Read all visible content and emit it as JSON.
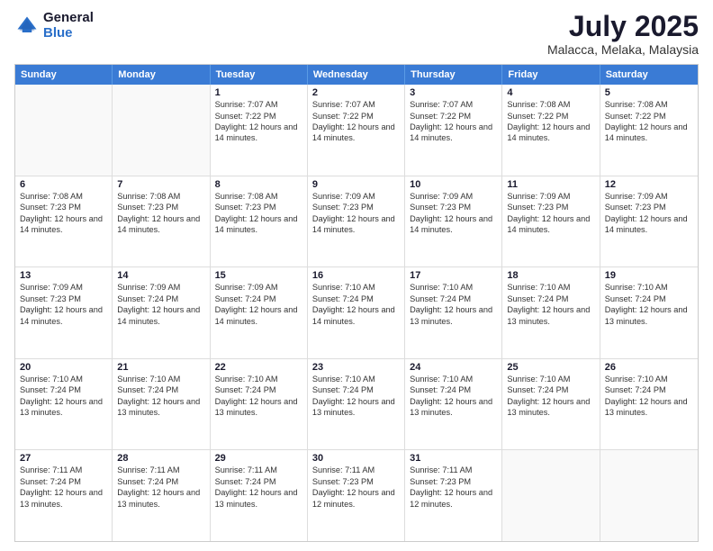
{
  "header": {
    "logo_general": "General",
    "logo_blue": "Blue",
    "title": "July 2025",
    "subtitle": "Malacca, Melaka, Malaysia"
  },
  "days_of_week": [
    "Sunday",
    "Monday",
    "Tuesday",
    "Wednesday",
    "Thursday",
    "Friday",
    "Saturday"
  ],
  "weeks": [
    [
      {
        "day": "",
        "empty": true
      },
      {
        "day": "",
        "empty": true
      },
      {
        "day": "1",
        "sunrise": "7:07 AM",
        "sunset": "7:22 PM",
        "daylight": "12 hours and 14 minutes."
      },
      {
        "day": "2",
        "sunrise": "7:07 AM",
        "sunset": "7:22 PM",
        "daylight": "12 hours and 14 minutes."
      },
      {
        "day": "3",
        "sunrise": "7:07 AM",
        "sunset": "7:22 PM",
        "daylight": "12 hours and 14 minutes."
      },
      {
        "day": "4",
        "sunrise": "7:08 AM",
        "sunset": "7:22 PM",
        "daylight": "12 hours and 14 minutes."
      },
      {
        "day": "5",
        "sunrise": "7:08 AM",
        "sunset": "7:22 PM",
        "daylight": "12 hours and 14 minutes."
      }
    ],
    [
      {
        "day": "6",
        "sunrise": "7:08 AM",
        "sunset": "7:23 PM",
        "daylight": "12 hours and 14 minutes."
      },
      {
        "day": "7",
        "sunrise": "7:08 AM",
        "sunset": "7:23 PM",
        "daylight": "12 hours and 14 minutes."
      },
      {
        "day": "8",
        "sunrise": "7:08 AM",
        "sunset": "7:23 PM",
        "daylight": "12 hours and 14 minutes."
      },
      {
        "day": "9",
        "sunrise": "7:09 AM",
        "sunset": "7:23 PM",
        "daylight": "12 hours and 14 minutes."
      },
      {
        "day": "10",
        "sunrise": "7:09 AM",
        "sunset": "7:23 PM",
        "daylight": "12 hours and 14 minutes."
      },
      {
        "day": "11",
        "sunrise": "7:09 AM",
        "sunset": "7:23 PM",
        "daylight": "12 hours and 14 minutes."
      },
      {
        "day": "12",
        "sunrise": "7:09 AM",
        "sunset": "7:23 PM",
        "daylight": "12 hours and 14 minutes."
      }
    ],
    [
      {
        "day": "13",
        "sunrise": "7:09 AM",
        "sunset": "7:23 PM",
        "daylight": "12 hours and 14 minutes."
      },
      {
        "day": "14",
        "sunrise": "7:09 AM",
        "sunset": "7:24 PM",
        "daylight": "12 hours and 14 minutes."
      },
      {
        "day": "15",
        "sunrise": "7:09 AM",
        "sunset": "7:24 PM",
        "daylight": "12 hours and 14 minutes."
      },
      {
        "day": "16",
        "sunrise": "7:10 AM",
        "sunset": "7:24 PM",
        "daylight": "12 hours and 14 minutes."
      },
      {
        "day": "17",
        "sunrise": "7:10 AM",
        "sunset": "7:24 PM",
        "daylight": "12 hours and 13 minutes."
      },
      {
        "day": "18",
        "sunrise": "7:10 AM",
        "sunset": "7:24 PM",
        "daylight": "12 hours and 13 minutes."
      },
      {
        "day": "19",
        "sunrise": "7:10 AM",
        "sunset": "7:24 PM",
        "daylight": "12 hours and 13 minutes."
      }
    ],
    [
      {
        "day": "20",
        "sunrise": "7:10 AM",
        "sunset": "7:24 PM",
        "daylight": "12 hours and 13 minutes."
      },
      {
        "day": "21",
        "sunrise": "7:10 AM",
        "sunset": "7:24 PM",
        "daylight": "12 hours and 13 minutes."
      },
      {
        "day": "22",
        "sunrise": "7:10 AM",
        "sunset": "7:24 PM",
        "daylight": "12 hours and 13 minutes."
      },
      {
        "day": "23",
        "sunrise": "7:10 AM",
        "sunset": "7:24 PM",
        "daylight": "12 hours and 13 minutes."
      },
      {
        "day": "24",
        "sunrise": "7:10 AM",
        "sunset": "7:24 PM",
        "daylight": "12 hours and 13 minutes."
      },
      {
        "day": "25",
        "sunrise": "7:10 AM",
        "sunset": "7:24 PM",
        "daylight": "12 hours and 13 minutes."
      },
      {
        "day": "26",
        "sunrise": "7:10 AM",
        "sunset": "7:24 PM",
        "daylight": "12 hours and 13 minutes."
      }
    ],
    [
      {
        "day": "27",
        "sunrise": "7:11 AM",
        "sunset": "7:24 PM",
        "daylight": "12 hours and 13 minutes."
      },
      {
        "day": "28",
        "sunrise": "7:11 AM",
        "sunset": "7:24 PM",
        "daylight": "12 hours and 13 minutes."
      },
      {
        "day": "29",
        "sunrise": "7:11 AM",
        "sunset": "7:24 PM",
        "daylight": "12 hours and 13 minutes."
      },
      {
        "day": "30",
        "sunrise": "7:11 AM",
        "sunset": "7:23 PM",
        "daylight": "12 hours and 12 minutes."
      },
      {
        "day": "31",
        "sunrise": "7:11 AM",
        "sunset": "7:23 PM",
        "daylight": "12 hours and 12 minutes."
      },
      {
        "day": "",
        "empty": true
      },
      {
        "day": "",
        "empty": true
      }
    ]
  ],
  "labels": {
    "sunrise": "Sunrise:",
    "sunset": "Sunset:",
    "daylight": "Daylight:"
  }
}
